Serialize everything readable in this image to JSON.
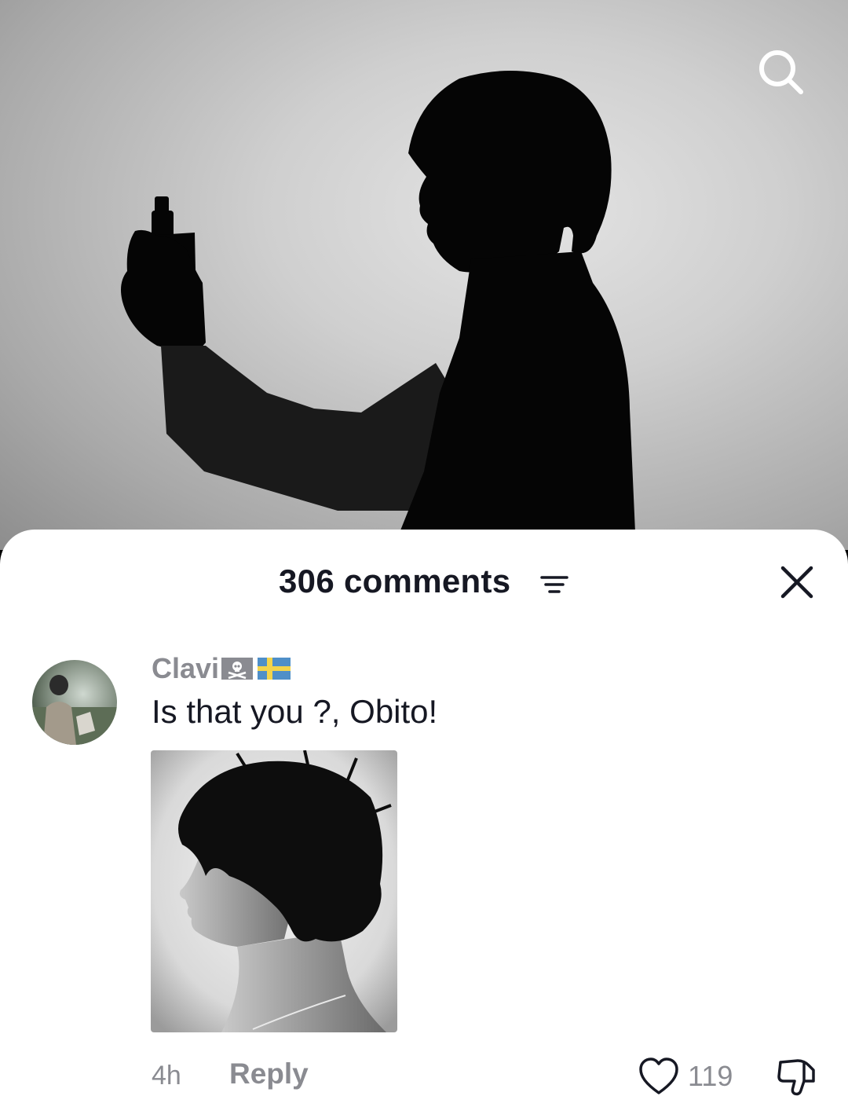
{
  "video": {
    "search_icon": "search-icon"
  },
  "comments_panel": {
    "title": "306 comments",
    "sort_icon": "filter-lines-icon",
    "close_icon": "close-icon"
  },
  "comment": {
    "username": "Clavi",
    "badges": [
      "pirate-flag-emoji",
      "sweden-flag-emoji"
    ],
    "text": "Is that you ?, Obito!",
    "time": "4h",
    "reply_label": "Reply",
    "like_count": "119"
  },
  "colors": {
    "primary_text": "#161823",
    "secondary_text": "#8a8b91",
    "sheet_bg": "#ffffff"
  }
}
